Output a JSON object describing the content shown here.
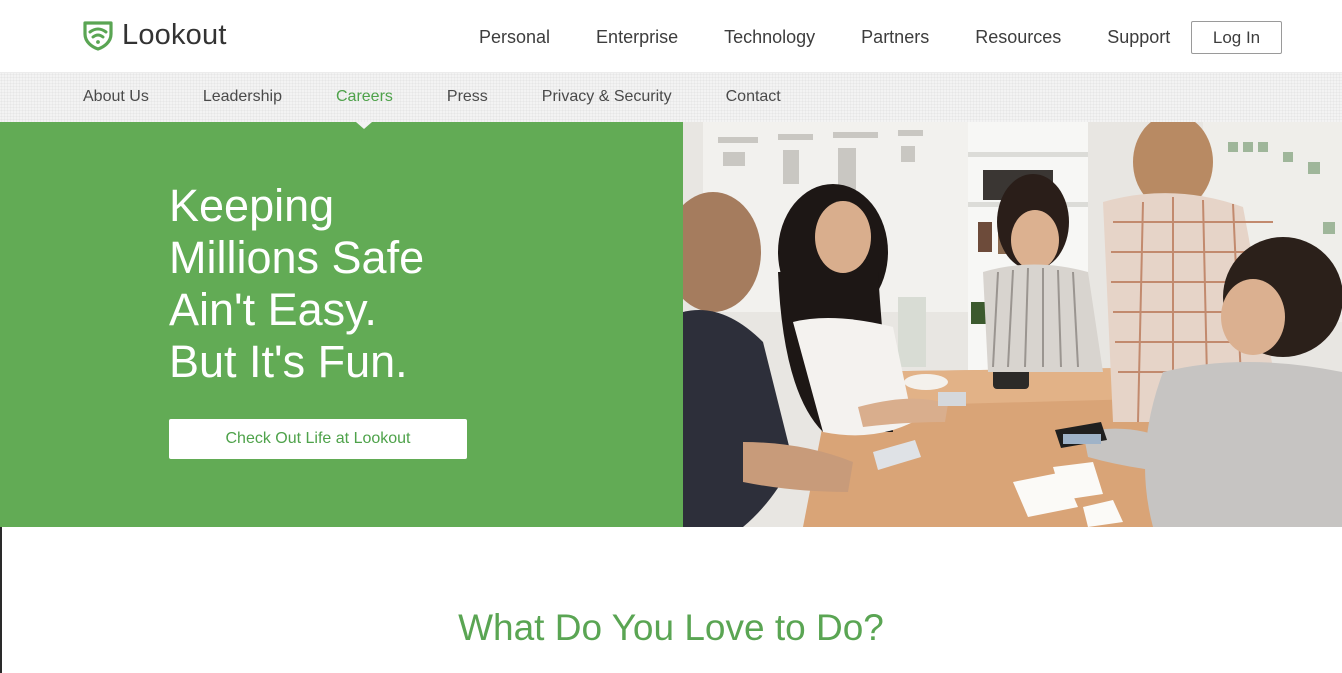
{
  "brand": {
    "name": "Lookout",
    "color": "#62ab55",
    "logo_icon": "shield-wifi-icon"
  },
  "main_nav": {
    "items": [
      "Personal",
      "Enterprise",
      "Technology",
      "Partners",
      "Resources",
      "Support"
    ],
    "login_label": "Log In"
  },
  "sub_nav": {
    "items": [
      "About Us",
      "Leadership",
      "Careers",
      "Press",
      "Privacy & Security",
      "Contact"
    ],
    "active": "Careers"
  },
  "hero": {
    "lines": [
      "Keeping",
      "Millions Safe",
      "Ain't Easy.",
      "But It's Fun."
    ],
    "cta_label": "Check Out Life at Lookout",
    "photo_icon": "team-photo"
  },
  "section": {
    "title": "What Do You Love to Do?"
  }
}
